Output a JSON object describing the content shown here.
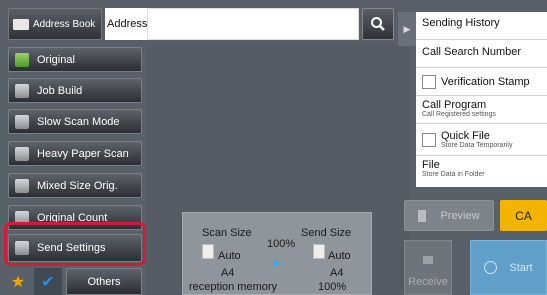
{
  "address": {
    "book_label": "Address Book",
    "field_label": "Address",
    "input_value": ""
  },
  "left_menu": {
    "items": [
      {
        "label": "Original"
      },
      {
        "label": "Job Build"
      },
      {
        "label": "Slow Scan Mode"
      },
      {
        "label": "Heavy Paper Scan"
      },
      {
        "label": "Mixed Size Orig."
      },
      {
        "label": "Original Count"
      },
      {
        "label": "Send Settings"
      }
    ],
    "others_label": "Others"
  },
  "info": {
    "scan_size_title": "Scan Size",
    "scan_size_mode": "Auto",
    "scan_size_value": "A4",
    "ratio": "100%",
    "send_size_title": "Send Size",
    "send_size_mode": "Auto",
    "send_size_value": "A4",
    "memory_label": "reception memory",
    "memory_value": "100%"
  },
  "right_panel": {
    "sending_history": "Sending History",
    "call_search_number": "Call Search Number",
    "verification_stamp": "Verification Stamp",
    "call_program": "Call Program",
    "call_program_sub": "Call Registered settings",
    "quick_file": "Quick File",
    "quick_file_sub": "Store Data Temporarily",
    "file": "File",
    "file_sub": "Store Data in Folder"
  },
  "actions": {
    "preview": "Preview",
    "ca": "CA",
    "receive": "Receive",
    "start": "Start"
  },
  "colors": {
    "highlight": "#d41a3a",
    "ca": "#f3b400",
    "start": "#5f9fc9",
    "star": "#f0a800",
    "check": "#2a8de0"
  }
}
